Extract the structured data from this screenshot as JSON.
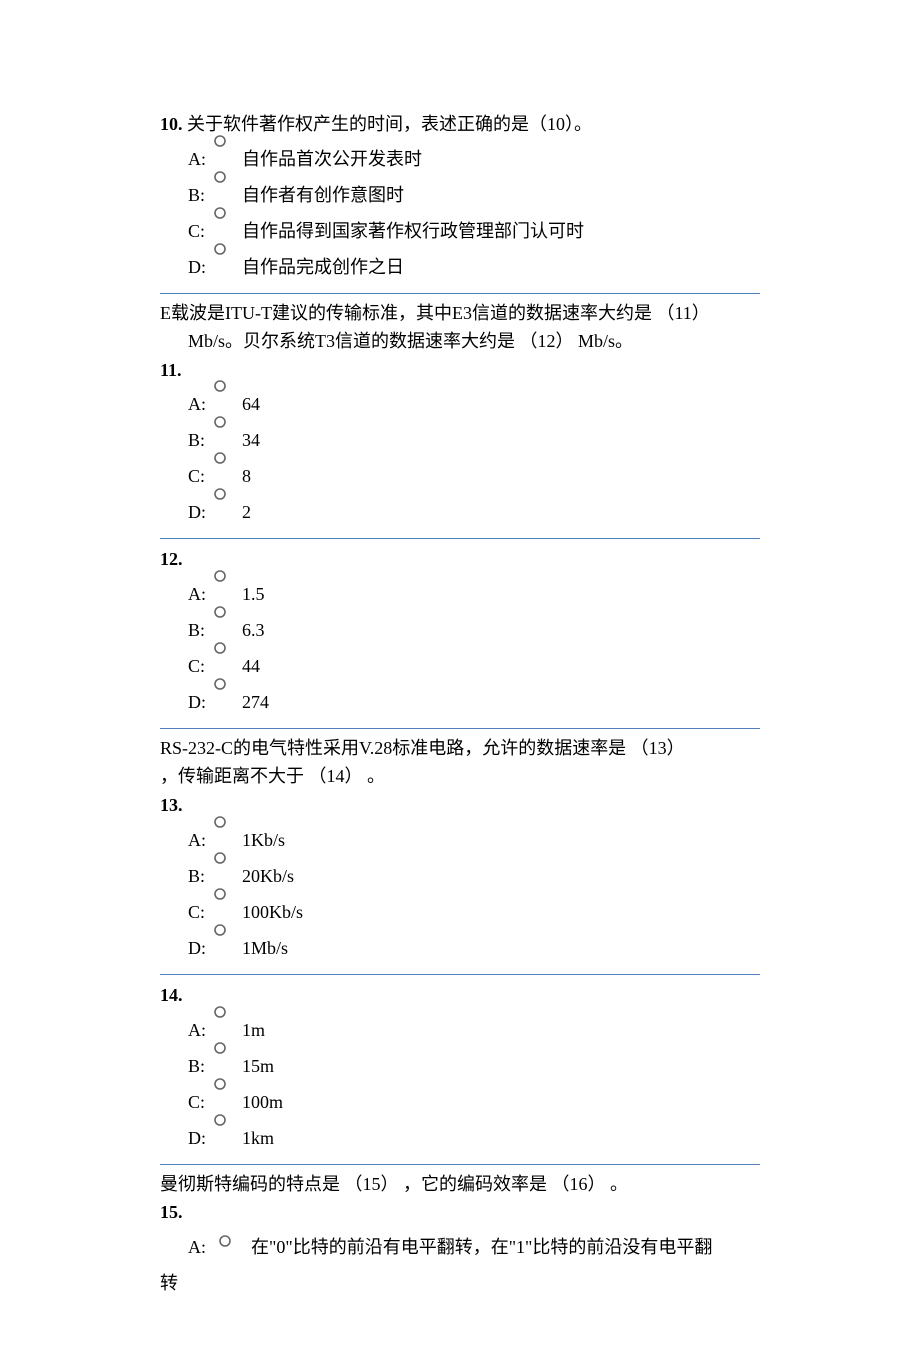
{
  "q10": {
    "num": "10.",
    "prompt": " 关于软件著作权产生的时间，表述正确的是（10）。",
    "opts": {
      "A": "自作品首次公开发表时",
      "B": "自作者有创作意图时",
      "C": "自作品得到国家著作权行政管理部门认可时",
      "D": "自作品完成创作之日"
    }
  },
  "group11_12": {
    "intro_l1": "E载波是ITU-T建议的传输标准，其中E3信道的数据速率大约是  （11）",
    "intro_l2": "Mb/s。贝尔系统T3信道的数据速率大约是  （12）  Mb/s。"
  },
  "q11": {
    "num": "11.",
    "opts": {
      "A": "64",
      "B": "34",
      "C": "8",
      "D": "2"
    }
  },
  "q12": {
    "num": "12.",
    "opts": {
      "A": "1.5",
      "B": "6.3",
      "C": "44",
      "D": "274"
    }
  },
  "group13_14": {
    "intro_l1": "RS-232-C的电气特性采用V.28标准电路，允许的数据速率是  （13）",
    "intro_l2": "，传输距离不大于  （14）  。"
  },
  "q13": {
    "num": "13.",
    "opts": {
      "A": "1Kb/s",
      "B": "20Kb/s",
      "C": "100Kb/s",
      "D": "1Mb/s"
    }
  },
  "q14": {
    "num": "14.",
    "opts": {
      "A": "1m",
      "B": "15m",
      "C": "100m",
      "D": "1km"
    }
  },
  "group15": {
    "intro": "曼彻斯特编码的特点是  （15）  ，它的编码效率是  （16）  。"
  },
  "q15": {
    "num": "15.",
    "optA_lead": "A:",
    "optA_text": "在\"0\"比特的前沿有电平翻转，在\"1\"比特的前沿没有电平翻",
    "optA_cont": "转"
  },
  "labels": {
    "A": "A:",
    "B": "B:",
    "C": "C:",
    "D": "D:"
  }
}
